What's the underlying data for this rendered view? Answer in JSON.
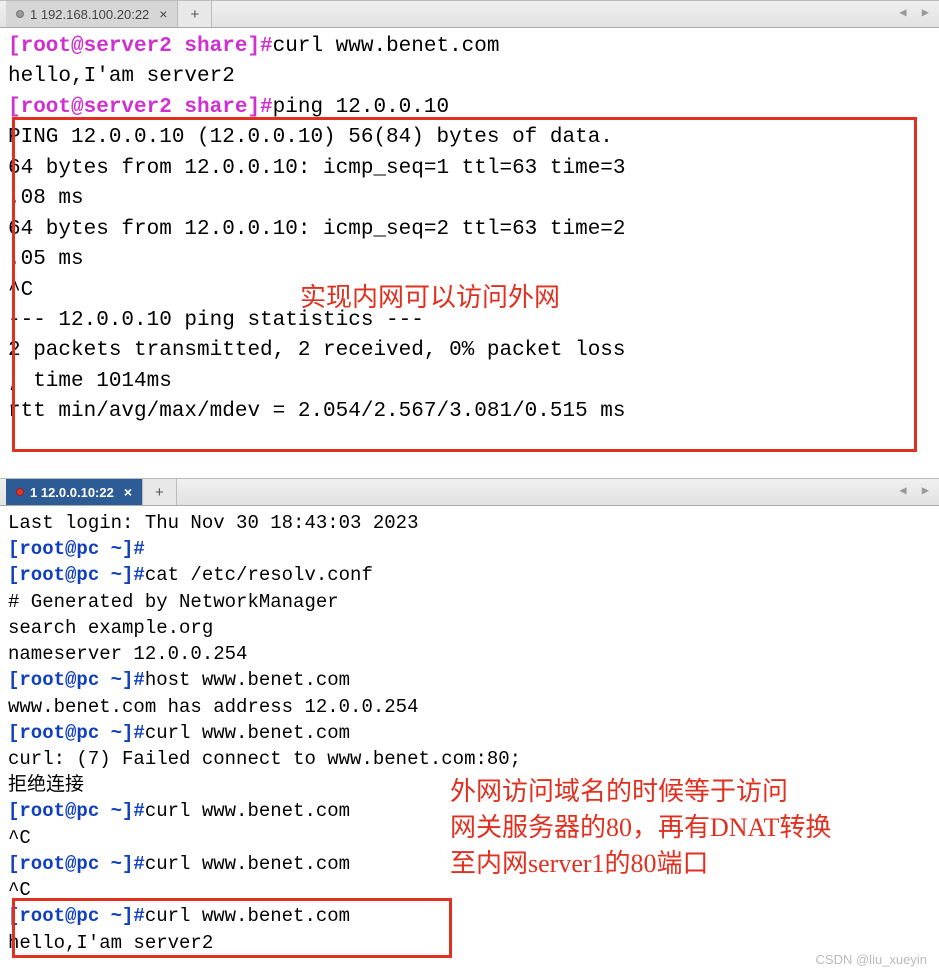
{
  "pane1": {
    "tab": {
      "label": "1 192.168.100.20:22"
    },
    "term": {
      "p1": "[root@server2 share]#",
      "c1": "curl www.benet.com",
      "o1": "hello,I'am server2",
      "p2": "[root@server2 share]#",
      "c2": "ping 12.0.0.10",
      "o2": "PING 12.0.0.10 (12.0.0.10) 56(84) bytes of data.",
      "o3": "64 bytes from 12.0.0.10: icmp_seq=1 ttl=63 time=3",
      "o3b": ".08 ms",
      "o4": "64 bytes from 12.0.0.10: icmp_seq=2 ttl=63 time=2",
      "o4b": ".05 ms",
      "o5": "^C",
      "o6": "--- 12.0.0.10 ping statistics ---",
      "o7": "2 packets transmitted, 2 received, 0% packet loss",
      "o7b": ", time 1014ms",
      "o8": "rtt min/avg/max/mdev = 2.054/2.567/3.081/0.515 ms"
    },
    "annotation": "实现内网可以访问外网"
  },
  "pane2": {
    "tab": {
      "label": "1 12.0.0.10:22"
    },
    "term": {
      "l1": "Last login: Thu Nov 30 18:43:03 2023",
      "p1": "[root@pc ~]#",
      "p2": "[root@pc ~]#",
      "c2": "cat /etc/resolv.conf",
      "o1": "# Generated by NetworkManager",
      "o2": "search example.org",
      "o3": "nameserver 12.0.0.254",
      "p3": "[root@pc ~]#",
      "c3": "host www.benet.com",
      "o4": "www.benet.com has address 12.0.0.254",
      "p4": "[root@pc ~]#",
      "c4": "curl www.benet.com",
      "o5": "curl: (7) Failed connect to www.benet.com:80;",
      "o5b": "拒绝连接",
      "p5": "[root@pc ~]#",
      "c5": "curl www.benet.com",
      "o6": "^C",
      "p6": "[root@pc ~]#",
      "c6": "curl www.benet.com",
      "o7": "^C",
      "p7": "[root@pc ~]#",
      "c7": "curl www.benet.com",
      "o8": "hello,I'am server2"
    },
    "annotation_l1": "外网访问域名的时候等于访问",
    "annotation_l2": "网关服务器的80，再有DNAT转换",
    "annotation_l3": "至内网server1的80端口"
  },
  "watermark": "CSDN @liu_xueyin",
  "icons": {
    "close": "×",
    "plus": "+",
    "arrows": "◀ ▶"
  }
}
